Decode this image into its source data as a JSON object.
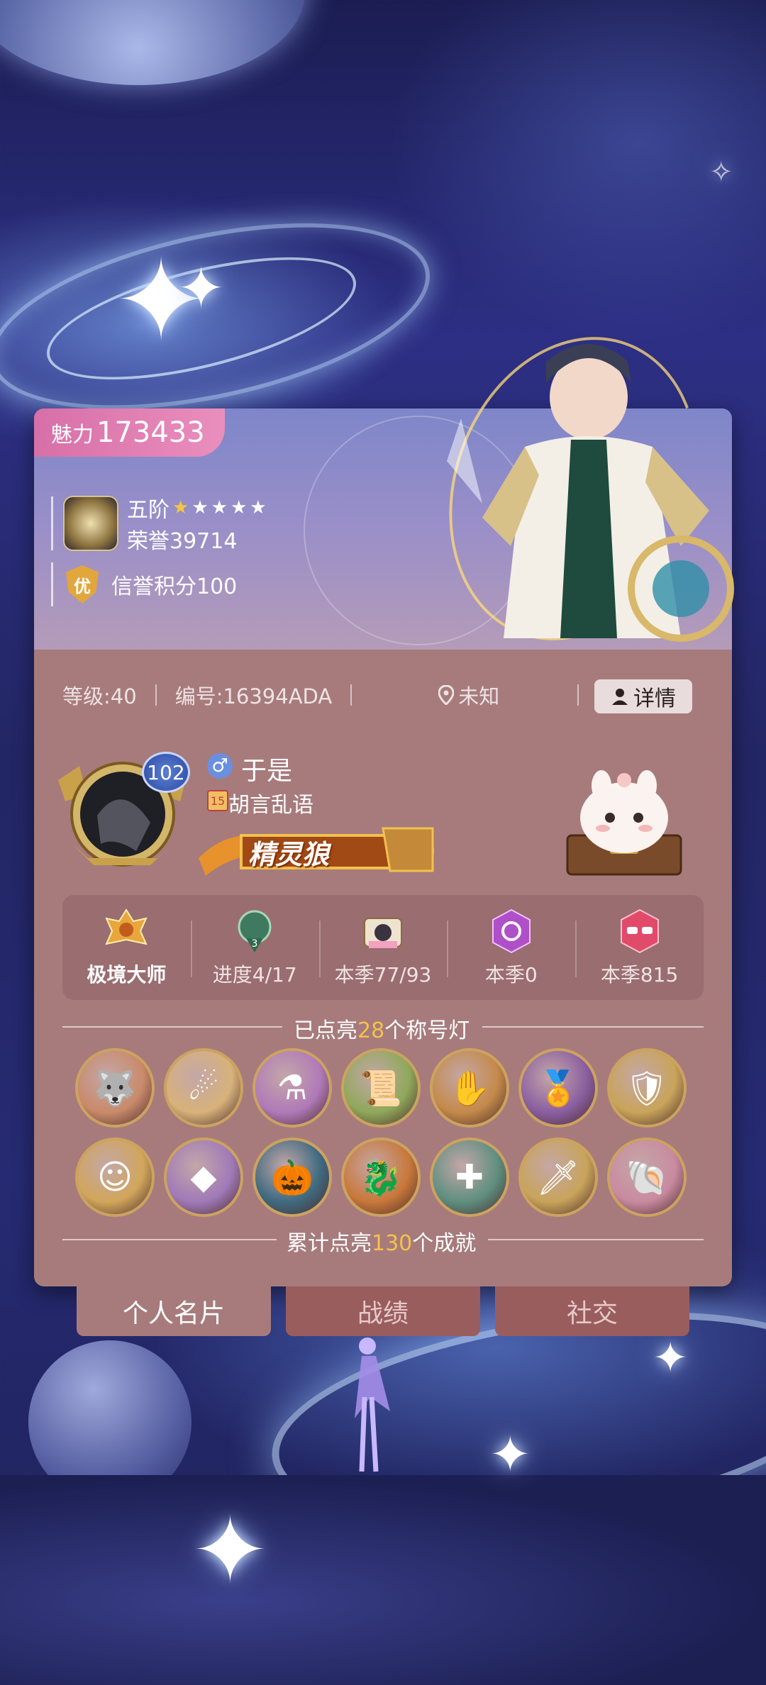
{
  "charm": {
    "label": "魅力",
    "value": "173433"
  },
  "rank": {
    "tier": "五阶",
    "stars": 5,
    "gold_stars": 1,
    "honor": "荣誉39714"
  },
  "credit": {
    "shield": "优",
    "text": "信誉积分100"
  },
  "info_bar": {
    "level": "等级:40",
    "id": "编号:16394ADA",
    "location": "未知",
    "details": "详情"
  },
  "profile": {
    "level_badge": "102",
    "gender_symbol": "♂",
    "name": "于是",
    "motto_icon_text": "15",
    "motto": "胡言乱语",
    "role_title": "精灵狼"
  },
  "stats": [
    {
      "label": "极境大师",
      "icon": "master-rank-icon"
    },
    {
      "label": "进度4/17",
      "badge_number": "3",
      "icon": "progress-emblem-icon"
    },
    {
      "label": "本季77/93",
      "icon": "camera-icon"
    },
    {
      "label": "本季0",
      "icon": "rose-icon"
    },
    {
      "label": "本季815",
      "icon": "sunglasses-icon"
    }
  ],
  "titles": {
    "prefix": "已点亮",
    "count": "28",
    "suffix": "个称号灯"
  },
  "achievements": {
    "prefix": "累计点亮",
    "count": "130",
    "suffix": "个成就"
  },
  "badges": [
    {
      "icon": "werewolf-icon",
      "color": "#c98a6a"
    },
    {
      "icon": "wolf-claw-icon",
      "color": "#d7b27a"
    },
    {
      "icon": "potion-bottles-icon",
      "color": "#b07ab8"
    },
    {
      "icon": "scroll-icon",
      "color": "#8fa85a"
    },
    {
      "icon": "gold-hand-icon",
      "color": "#c48a4a"
    },
    {
      "icon": "gold-medal-icon",
      "color": "#8a5fa0"
    },
    {
      "icon": "shield-sword-icon",
      "color": "#c9a45a"
    },
    {
      "icon": "blonde-hero-icon",
      "color": "#d1a65a"
    },
    {
      "icon": "crystal-icon",
      "color": "#a07ab8"
    },
    {
      "icon": "pumpkin-icon",
      "color": "#3f6a80"
    },
    {
      "icon": "dragon-book-icon",
      "color": "#c8783a"
    },
    {
      "icon": "crossbow-icon",
      "color": "#5f8f80"
    },
    {
      "icon": "dagger-icon",
      "color": "#c8a45a"
    },
    {
      "icon": "seashell-icon",
      "color": "#c98aa0"
    }
  ],
  "tabs": [
    {
      "label": "个人名片",
      "active": true
    },
    {
      "label": "战绩",
      "active": false
    },
    {
      "label": "社交",
      "active": false
    }
  ],
  "colors": {
    "card": "#a77b7c",
    "charm_pill": "#d86fa8",
    "highlight": "#f3c24a",
    "tab_inactive": "#9a5d5e"
  }
}
